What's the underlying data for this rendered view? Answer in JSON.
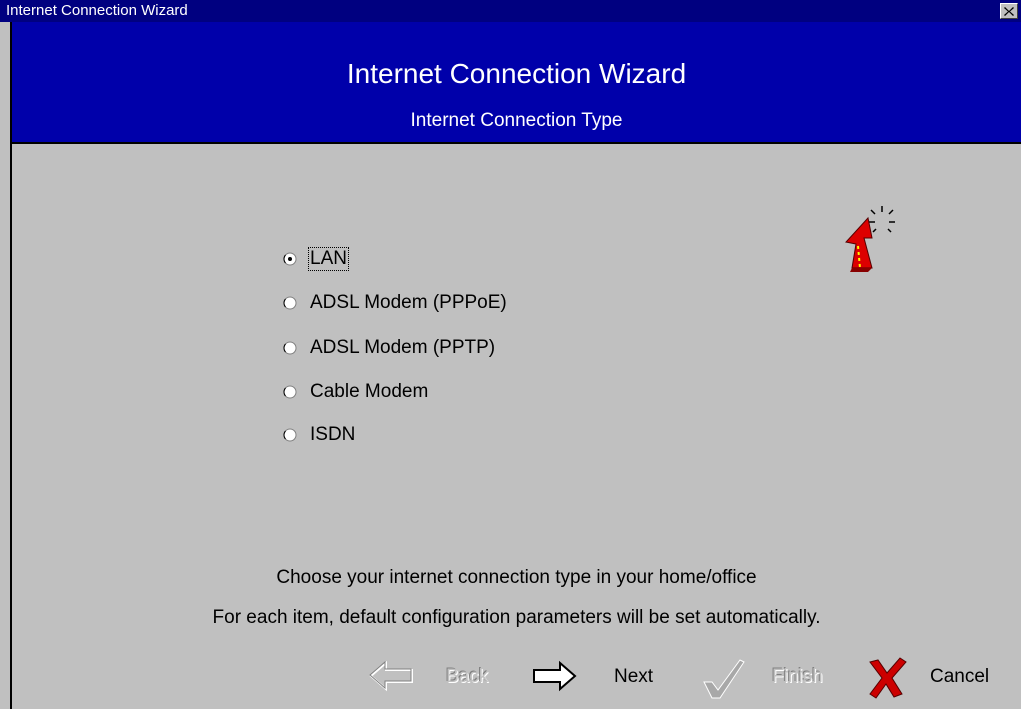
{
  "window": {
    "title": "Internet Connection Wizard"
  },
  "header": {
    "title": "Internet Connection Wizard",
    "subtitle": "Internet Connection Type"
  },
  "options": {
    "selected": "LAN",
    "items": [
      {
        "label": "LAN",
        "checked": true
      },
      {
        "label": "ADSL Modem (PPPoE)",
        "checked": false
      },
      {
        "label": "ADSL Modem (PPTP)",
        "checked": false
      },
      {
        "label": "Cable Modem",
        "checked": false
      },
      {
        "label": "ISDN",
        "checked": false
      }
    ]
  },
  "info": {
    "line1": "Choose your internet connection type in your home/office",
    "line2": "For each item, default configuration parameters will be set automatically."
  },
  "nav": {
    "back": {
      "label": "Back",
      "enabled": false,
      "icon": "arrow-left-icon"
    },
    "next": {
      "label": "Next",
      "enabled": true,
      "icon": "arrow-right-icon"
    },
    "finish": {
      "label": "Finish",
      "enabled": false,
      "icon": "checkmark-icon"
    },
    "cancel": {
      "label": "Cancel",
      "enabled": true,
      "icon": "red-x-icon"
    }
  },
  "colors": {
    "titlebar": "#000080",
    "header": "#0000aa",
    "background": "#c0c0c0",
    "cancel_x": "#cc0000",
    "wizard_icon": "#dd0000"
  }
}
